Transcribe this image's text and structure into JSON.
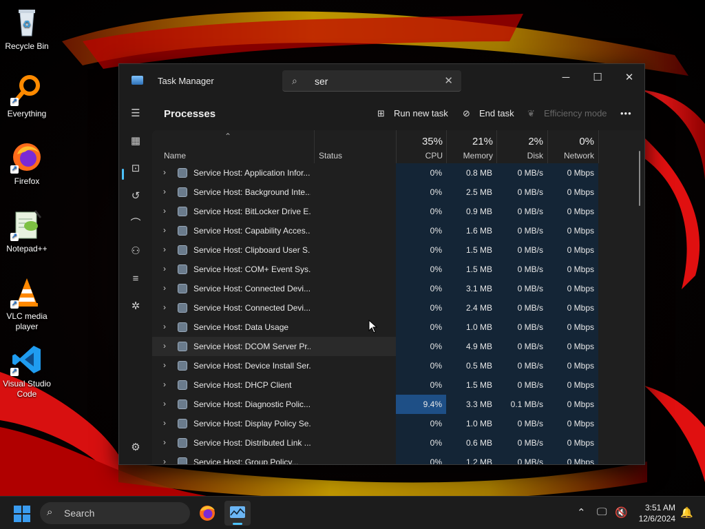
{
  "desktop": {
    "icons": [
      {
        "label": "Recycle Bin"
      },
      {
        "label": "Everything"
      },
      {
        "label": "Firefox"
      },
      {
        "label": "Notepad++"
      },
      {
        "label": "VLC media player"
      },
      {
        "label": "Visual Studio Code"
      }
    ]
  },
  "window": {
    "title": "Task Manager",
    "search_value": "ser",
    "page_title": "Processes",
    "toolbar": {
      "run_new_task": "Run new task",
      "end_task": "End task",
      "efficiency_mode": "Efficiency mode",
      "more": "•••"
    },
    "columns": {
      "name": "Name",
      "status": "Status",
      "cpu_pct": "35%",
      "cpu": "CPU",
      "memory_pct": "21%",
      "memory": "Memory",
      "disk_pct": "2%",
      "disk": "Disk",
      "network_pct": "0%",
      "network": "Network"
    },
    "rows": [
      {
        "name": "Service Host: Application Infor...",
        "cpu": "0%",
        "memory": "0.8 MB",
        "disk": "0 MB/s",
        "network": "0 Mbps"
      },
      {
        "name": "Service Host: Background Inte...",
        "cpu": "0%",
        "memory": "2.5 MB",
        "disk": "0 MB/s",
        "network": "0 Mbps"
      },
      {
        "name": "Service Host: BitLocker Drive E...",
        "cpu": "0%",
        "memory": "0.9 MB",
        "disk": "0 MB/s",
        "network": "0 Mbps"
      },
      {
        "name": "Service Host: Capability Acces...",
        "cpu": "0%",
        "memory": "1.6 MB",
        "disk": "0 MB/s",
        "network": "0 Mbps"
      },
      {
        "name": "Service Host: Clipboard User S...",
        "cpu": "0%",
        "memory": "1.5 MB",
        "disk": "0 MB/s",
        "network": "0 Mbps"
      },
      {
        "name": "Service Host: COM+ Event Sys...",
        "cpu": "0%",
        "memory": "1.5 MB",
        "disk": "0 MB/s",
        "network": "0 Mbps"
      },
      {
        "name": "Service Host: Connected Devi...",
        "cpu": "0%",
        "memory": "3.1 MB",
        "disk": "0 MB/s",
        "network": "0 Mbps"
      },
      {
        "name": "Service Host: Connected Devi...",
        "cpu": "0%",
        "memory": "2.4 MB",
        "disk": "0 MB/s",
        "network": "0 Mbps"
      },
      {
        "name": "Service Host: Data Usage",
        "cpu": "0%",
        "memory": "1.0 MB",
        "disk": "0 MB/s",
        "network": "0 Mbps"
      },
      {
        "name": "Service Host: DCOM Server Pr...",
        "cpu": "0%",
        "memory": "4.9 MB",
        "disk": "0 MB/s",
        "network": "0 Mbps"
      },
      {
        "name": "Service Host: Device Install Ser...",
        "cpu": "0%",
        "memory": "0.5 MB",
        "disk": "0 MB/s",
        "network": "0 Mbps"
      },
      {
        "name": "Service Host: DHCP Client",
        "cpu": "0%",
        "memory": "1.5 MB",
        "disk": "0 MB/s",
        "network": "0 Mbps"
      },
      {
        "name": "Service Host: Diagnostic Polic...",
        "cpu": "9.4%",
        "memory": "3.3 MB",
        "disk": "0.1 MB/s",
        "network": "0 Mbps"
      },
      {
        "name": "Service Host: Display Policy Se...",
        "cpu": "0%",
        "memory": "1.0 MB",
        "disk": "0 MB/s",
        "network": "0 Mbps"
      },
      {
        "name": "Service Host: Distributed Link ...",
        "cpu": "0%",
        "memory": "0.6 MB",
        "disk": "0 MB/s",
        "network": "0 Mbps"
      },
      {
        "name": "Service Host: Group Policy...",
        "cpu": "0%",
        "memory": "1.2 MB",
        "disk": "0 MB/s",
        "network": "0 Mbps"
      }
    ]
  },
  "taskbar": {
    "search_label": "Search",
    "time": "3:51 AM",
    "date": "12/6/2024"
  },
  "colors": {
    "accent": "#4cc2ff",
    "heat_low": "#142536",
    "heat_high": "#1e4f86"
  }
}
